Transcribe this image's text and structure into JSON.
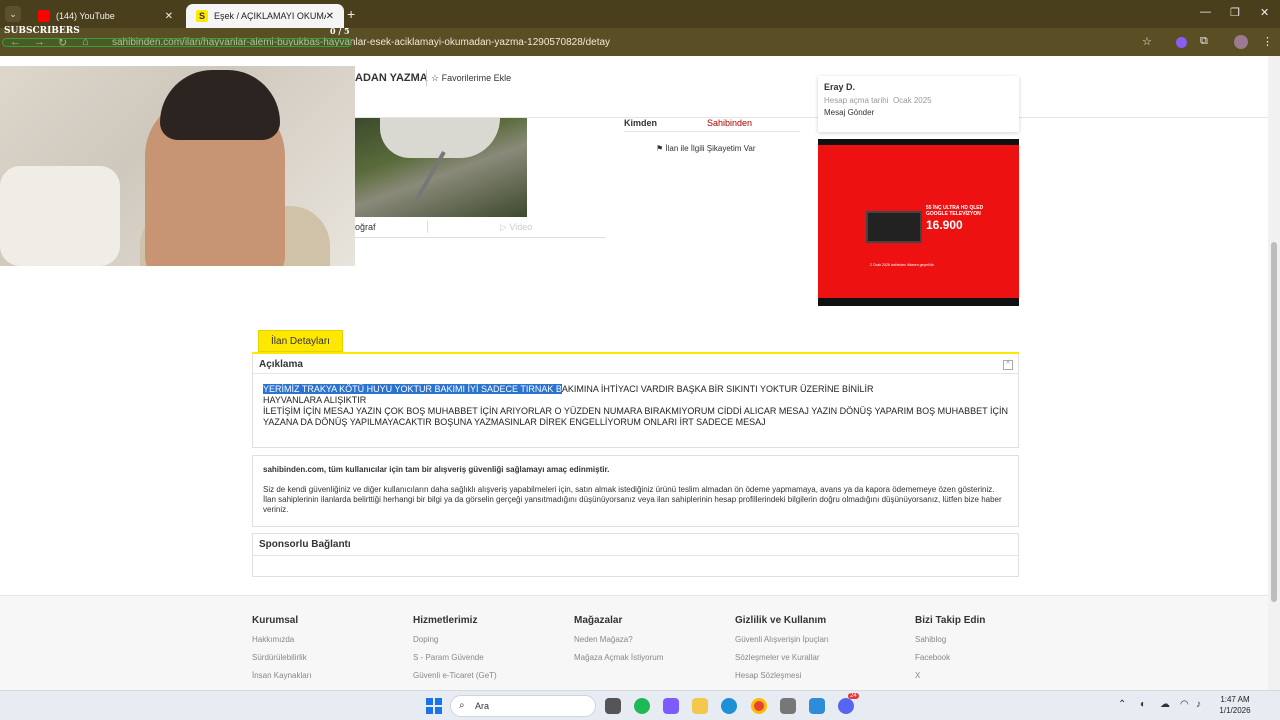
{
  "browser": {
    "tabs": [
      {
        "title": "(144) YouTube",
        "active": false
      },
      {
        "title": "Eşek / AÇIKLAMAYI OKUMADAN",
        "active": true
      }
    ],
    "url": "sahibinden.com/ilan/hayvanlar-alemi-buyukbas-hayvanlar-esek-aciklamayi-okumadan-yazma-1290570828/detay",
    "colors": {
      "chrome": "#4a3f1d",
      "accent": "#ffe800"
    }
  },
  "stream_overlay": {
    "subscribers_label": "SUBSCRIBERS",
    "subscribers_count": "0 / 5"
  },
  "listing": {
    "title_fragment": "ADAN YAZMA",
    "favorite_label": "Favorilerime Ekle",
    "photo_tab_label": "oğraf",
    "video_tab_label": "Video",
    "info": {
      "key": "Kimden",
      "value": "Sahibinden"
    },
    "complaint_label": "İlan ile İlgili Şikayetim Var"
  },
  "seller": {
    "name": "Eray D.",
    "account_date_label": "Hesap açma tarihi",
    "account_date": "Ocak 2025",
    "message_label": "Mesaj Gönder"
  },
  "ad": {
    "text": "55 İNÇ ULTRA HD QLED GOOGLE TELEVİZYON",
    "price": "16.900",
    "fine_print": "2 Ocak 2026 tarihinden itibaren geçerlidir."
  },
  "details_tab": "İlan Detayları",
  "description": {
    "heading": "Açıklama",
    "highlighted": "YERİMİZ TRAKYA KÖTÜ HUYU YOKTUR BAKIMI İYİ SADECE TIRNAK B",
    "line1_rest": "AKIMINA İHTİYACI VARDIR BAŞKA BİR SIKINTI YOKTUR ÜZERİNE BİNİLİR",
    "line2": "HAYVANLARA ALIŞIKTIR",
    "line3": "İLETİŞİM İÇİN MESAJ YAZIN ÇOK BOŞ MUHABBET İÇİN ARIYORLAR O YÜZDEN NUMARA BIRAKMIYORUM CİDDİ ALICAR MESAJ YAZIN DÖNÜŞ YAPARIM BOŞ MUHABBET İÇİN YAZANA DA DÖNÜŞ YAPILMAYACAKTIR BOŞUNA YAZMASINLAR DİREK ENGELLİYORUM ONLARI İRT SADECE MESAJ"
  },
  "safety": {
    "heading": "sahibinden.com, tüm kullanıcılar için tam bir alışveriş güvenliği sağlamayı amaç edinmiştir.",
    "body": "Siz de kendi güvenliğiniz ve diğer kullanıcıların daha sağlıklı alışveriş yapabilmeleri için, satın almak istediğiniz ürünü teslim almadan ön ödeme yapmamaya, avans ya da kapora ödememeye özen gösteriniz. İlan sahiplerinin ilanlarda belirttiği herhangi bir bilgi ya da görselin gerçeği yansıtmadığını düşünüyorsanız veya ilan sahiplerinin hesap profillerindeki bilgilerin doğru olmadığını düşünüyorsanız, lütfen bize haber veriniz."
  },
  "sponsor_heading": "Sponsorlu Bağlantı",
  "footer": {
    "columns": [
      {
        "heading": "Kurumsal",
        "items": [
          "Hakkımızda",
          "Sürdürülebilirlik",
          "İnsan Kaynakları"
        ]
      },
      {
        "heading": "Hizmetlerimiz",
        "items": [
          "Doping",
          "S - Param Güvende",
          "Güvenli e-Ticaret (GeT)"
        ]
      },
      {
        "heading": "Mağazalar",
        "items": [
          "Neden Mağaza?",
          "Mağaza Açmak İstiyorum"
        ]
      },
      {
        "heading": "Gizlilik ve Kullanım",
        "items": [
          "Güvenli Alışverişin İpuçları",
          "Sözleşmeler ve Kurallar",
          "Hesap Sözleşmesi"
        ]
      },
      {
        "heading": "Bizi Takip Edin",
        "items": [
          "Sahiblog",
          "Facebook",
          "X"
        ]
      }
    ]
  },
  "taskbar": {
    "search_placeholder": "Ara",
    "time": "1:47 AM",
    "date": "1/1/2026",
    "discord_badge": "24"
  }
}
